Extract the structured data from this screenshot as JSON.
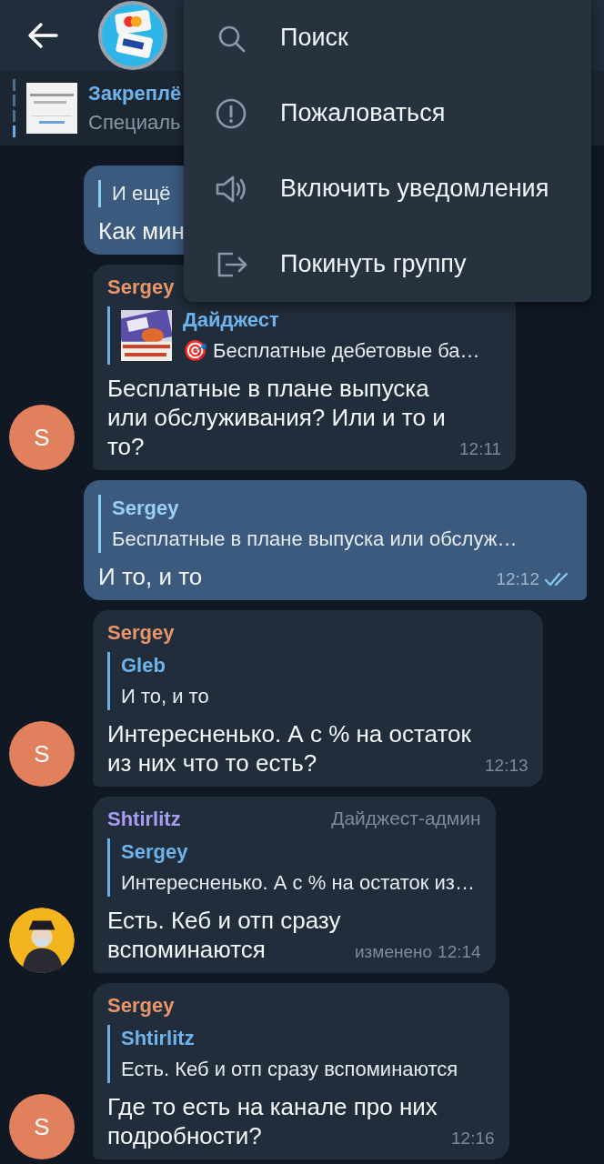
{
  "pinned": {
    "title": "Закреплё",
    "text": "Специаль"
  },
  "menu": {
    "items": [
      {
        "kind": "search",
        "label": "Поиск"
      },
      {
        "kind": "report",
        "label": "Пожаловаться"
      },
      {
        "kind": "unmute",
        "label": "Включить уведомления"
      },
      {
        "kind": "leave",
        "label": "Покинуть группу"
      }
    ]
  },
  "messages": [
    {
      "outgoing": true,
      "reply": {
        "text": "И ещё"
      },
      "text": "Как мин"
    },
    {
      "outgoing": false,
      "sender": "Sergey",
      "color": "#e8956a",
      "avatar": {
        "letter": "S",
        "color": "#e0805c"
      },
      "reply": {
        "author": "Дайджест",
        "text": "🎯 Бесплатные дебетовые ба…"
      },
      "text": "Бесплатные в плане выпуска или обслуживания? Или и то и то?",
      "time": "12:11"
    },
    {
      "outgoing": true,
      "reply": {
        "author": "Sergey",
        "text": "Бесплатные в плане выпуска или обслуж…"
      },
      "text": "И то, и то",
      "time": "12:12",
      "read": true
    },
    {
      "outgoing": false,
      "sender": "Sergey",
      "color": "#e8956a",
      "avatar": {
        "letter": "S",
        "color": "#e0805c"
      },
      "reply": {
        "author": "Gleb",
        "text": "И то, и то"
      },
      "text": "Интересненько. А с % на остаток из них что то есть?",
      "time": "12:13"
    },
    {
      "outgoing": false,
      "sender": "Shtirlitz",
      "color": "#a99cf0",
      "badge": "Дайджест-админ",
      "reply": {
        "author": "Sergey",
        "text": "Интересненько. А с % на остаток из…"
      },
      "text": "Есть. Кеб и отп сразу вспоминаются",
      "edited": "изменено",
      "time": "12:14"
    },
    {
      "outgoing": false,
      "sender": "Sergey",
      "color": "#e8956a",
      "avatar": {
        "letter": "S",
        "color": "#e0805c"
      },
      "reply": {
        "author": "Shtirlitz",
        "text": "Есть. Кеб и отп сразу вспоминаются"
      },
      "text": "Где то есть на канале про них подробности?",
      "time": "12:16"
    }
  ]
}
